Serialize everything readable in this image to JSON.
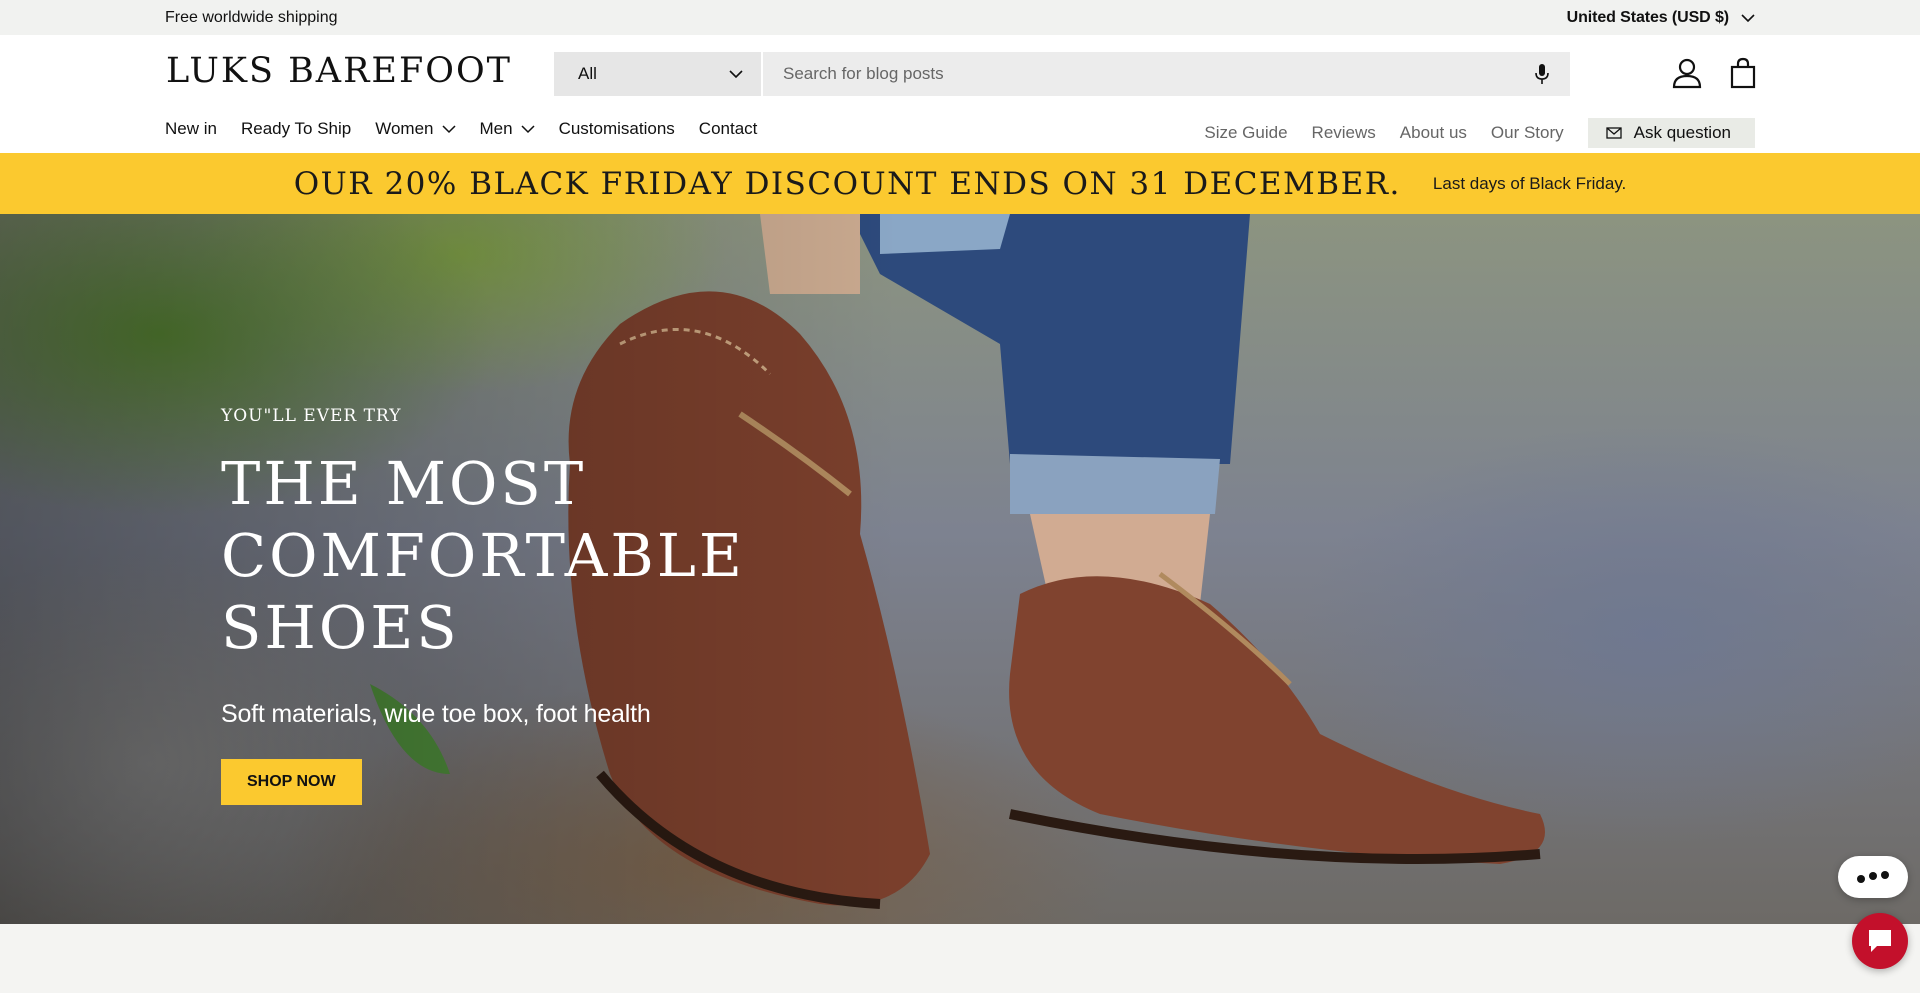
{
  "announcement": {
    "shipping": "Free worldwide shipping",
    "country": "United States (USD $)"
  },
  "header": {
    "logo": "LUKS BAREFOOT",
    "search": {
      "category": "All",
      "placeholder": "Search for blog posts"
    },
    "icons": [
      "account-icon",
      "cart-icon",
      "microphone-icon"
    ]
  },
  "nav": {
    "left": [
      "New in",
      "Ready To Ship",
      "Women",
      "Men",
      "Customisations",
      "Contact"
    ],
    "right": [
      "Size Guide",
      "Reviews",
      "About us",
      "Our Story"
    ],
    "ask": "Ask question"
  },
  "promo": {
    "headline": "OUR 20% BLACK FRIDAY DISCOUNT ENDS ON 31 DECEMBER.",
    "note": "Last days of Black Friday."
  },
  "hero": {
    "kicker": "YOU\"LL EVER TRY",
    "title": "THE MOST COMFORTABLE SHOES",
    "subtitle": "Soft materials, wide toe box, foot health",
    "cta": "SHOP NOW"
  },
  "colors": {
    "accent": "#fbc92f",
    "chat": "#c3102b"
  }
}
